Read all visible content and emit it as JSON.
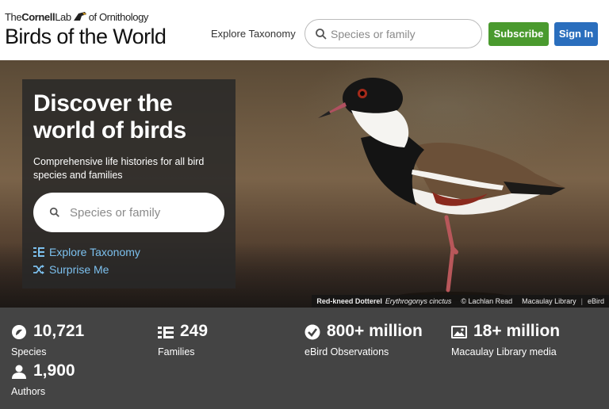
{
  "header": {
    "logo_the": "The",
    "logo_cornell": "Cornell",
    "logo_lab": "Lab",
    "logo_of": "of Ornithology",
    "logo_main": "Birds of the World",
    "explore_label": "Explore Taxonomy",
    "search_placeholder": "Species or family",
    "subscribe_label": "Subscribe",
    "signin_label": "Sign In"
  },
  "hero": {
    "title": "Discover the world of birds",
    "subtitle": "Comprehensive life histories for all bird species and families",
    "search_placeholder": "Species or family",
    "links": [
      {
        "label": "Explore Taxonomy",
        "icon": "taxonomy-icon"
      },
      {
        "label": "Surprise Me",
        "icon": "shuffle-icon"
      }
    ],
    "credit": {
      "common_name": "Red-kneed Dotterel",
      "scientific_name": "Erythrogonys cinctus",
      "photographer": "© Lachlan Read",
      "source": "Macaulay Library",
      "source2": "eBird"
    }
  },
  "stats": [
    {
      "value": "10,721",
      "label": "Species",
      "icon": "species-icon"
    },
    {
      "value": "249",
      "label": "Families",
      "icon": "taxonomy-icon"
    },
    {
      "value": "800+ million",
      "label": "eBird Observations",
      "icon": "check-circle-icon"
    },
    {
      "value": "18+ million",
      "label": "Macaulay Library media",
      "icon": "image-icon"
    },
    {
      "value": "1,900",
      "label": "Authors",
      "icon": "person-icon"
    }
  ],
  "colors": {
    "subscribe": "#4a9a2e",
    "signin": "#2a6ebd",
    "link": "#7cc0ee",
    "stats_bg": "#444444"
  }
}
